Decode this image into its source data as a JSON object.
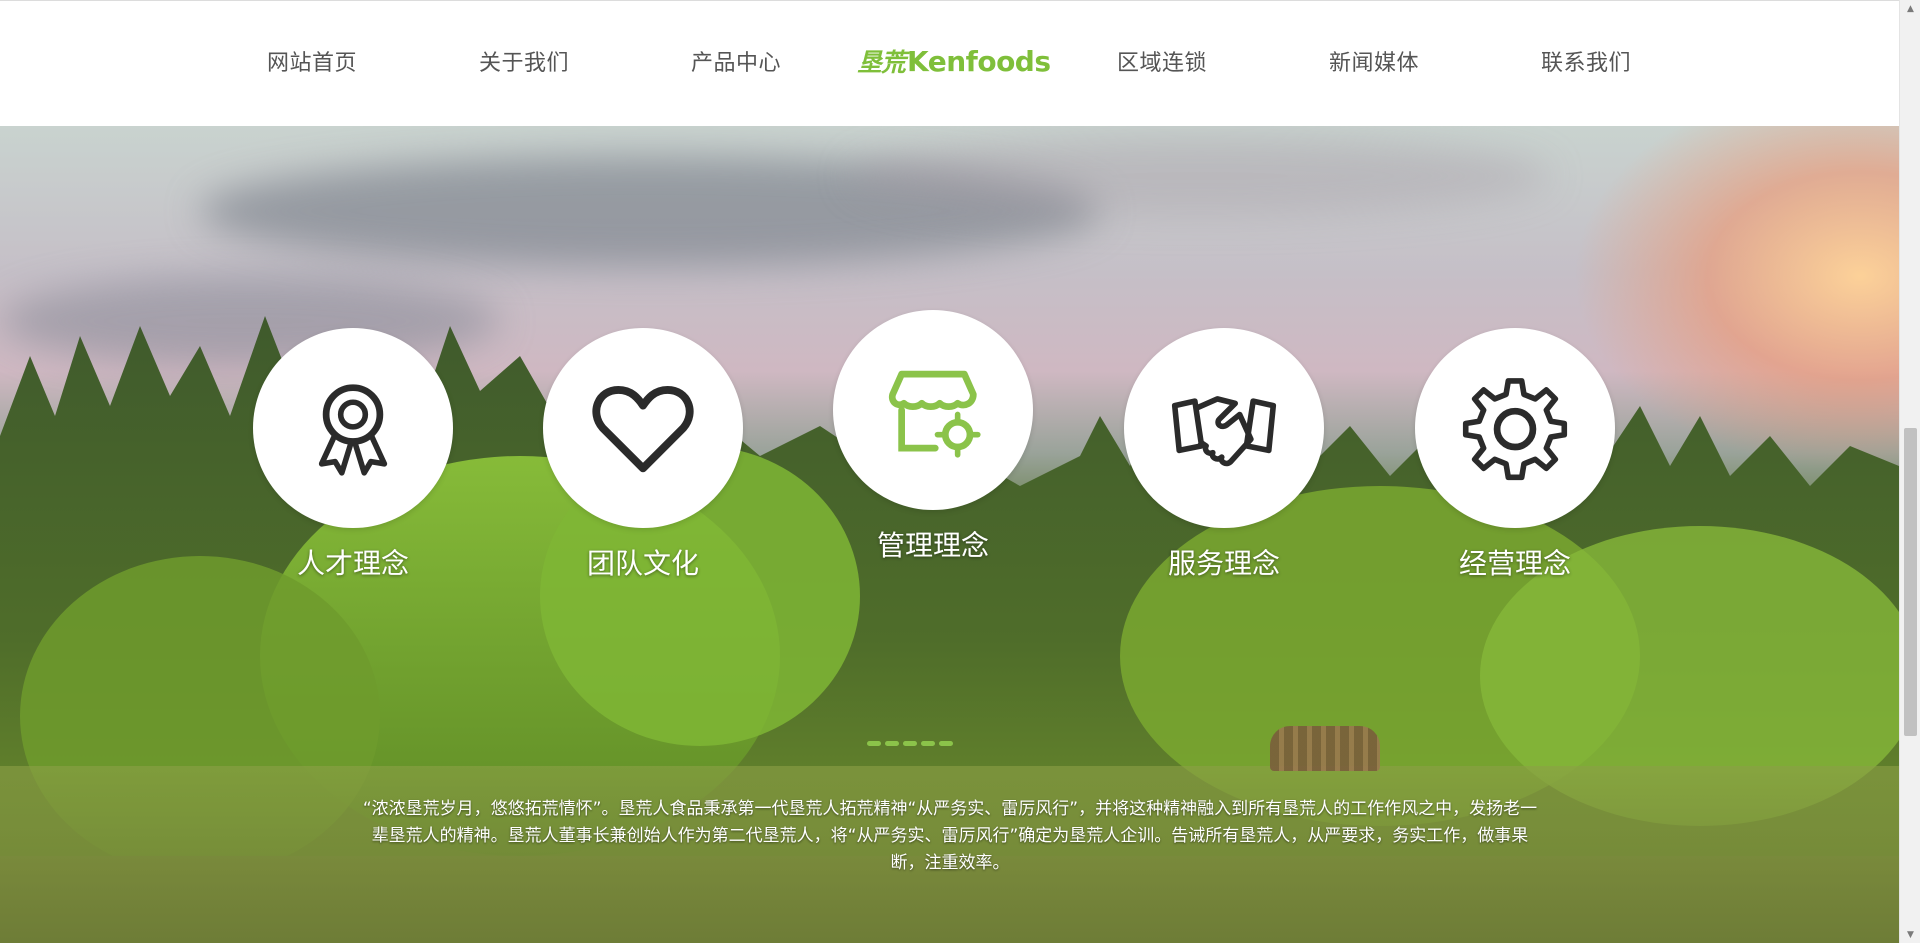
{
  "nav": {
    "items": [
      {
        "label": "网站首页"
      },
      {
        "label": "关于我们"
      },
      {
        "label": "产品中心"
      },
      {
        "label": "区域连锁"
      },
      {
        "label": "新闻媒体"
      },
      {
        "label": "联系我们"
      }
    ],
    "logo_cn": "垦荒",
    "logo_en": "Kenfoods",
    "logo_color": "#7fbf3a"
  },
  "concepts": [
    {
      "label": "人才理念",
      "icon": "award-ribbon-icon"
    },
    {
      "label": "团队文化",
      "icon": "heart-icon"
    },
    {
      "label": "管理理念",
      "icon": "store-gear-icon"
    },
    {
      "label": "服务理念",
      "icon": "handshake-icon"
    },
    {
      "label": "经营理念",
      "icon": "gear-icon"
    }
  ],
  "description": "“浓浓垦荒岁月，悠悠拓荒情怀”。垦荒人食品秉承第一代垦荒人拓荒精神“从严务实、雷厉风行”，并将这种精神融入到所有垦荒人的工作作风之中，发扬老一辈垦荒人的精神。垦荒人董事长兼创始人作为第二代垦荒人，将“从严务实、雷厉风行”确定为垦荒人企训。告诫所有垦荒人，从严要求，务实工作，做事果断，注重效率。",
  "colors": {
    "accent": "#8bc34a",
    "icon_dark": "#2b2b2b",
    "icon_green": "#8bc34a"
  }
}
